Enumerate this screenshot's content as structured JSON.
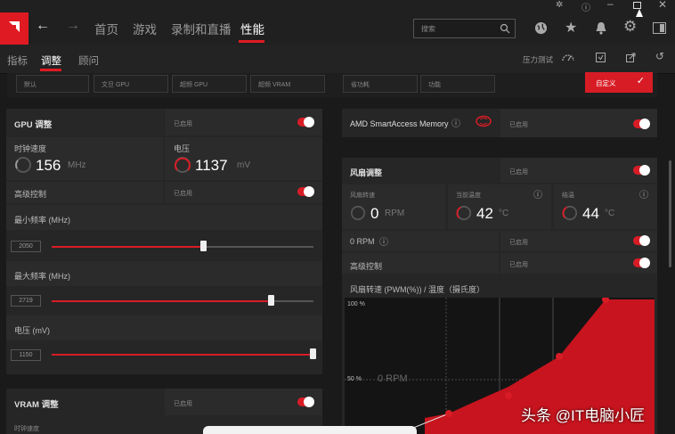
{
  "nav": {
    "items": [
      "首页",
      "游戏",
      "录制和直播",
      "性能"
    ],
    "active_index": 3
  },
  "search": {
    "placeholder": "搜索"
  },
  "subnav": {
    "items": [
      "指标",
      "调整",
      "顾问"
    ],
    "active_index": 1,
    "stress_test": "压力测试"
  },
  "presets": {
    "items": [
      "默认",
      "文旦 GPU",
      "超频 GPU",
      "超频 VRAM",
      "省功耗",
      "功能"
    ],
    "custom_label": "自定义"
  },
  "gpu": {
    "title": "GPU 调整",
    "status": "已启用",
    "clock_label": "时钟速度",
    "clock_value": "156",
    "clock_unit": "MHz",
    "voltage_label": "电压",
    "voltage_value": "1137",
    "voltage_unit": "mV",
    "advanced_label": "高级控制",
    "advanced_status": "已启用",
    "min_freq_label": "最小频率 (MHz)",
    "min_freq_value": "2050",
    "min_freq_fraction": 0.58,
    "max_freq_label": "最大频率 (MHz)",
    "max_freq_value": "2719",
    "max_freq_fraction": 0.84,
    "volt_slider_label": "电压 (mV)",
    "volt_slider_value": "1150",
    "volt_slider_fraction": 1.0
  },
  "vram": {
    "title": "VRAM 调整",
    "status": "已启用",
    "clock_label": "时钟速度"
  },
  "sam": {
    "title": "AMD SmartAccess Memory",
    "status": "已启用"
  },
  "fan": {
    "title": "风扇调整",
    "status": "已启用",
    "speed_label": "风扇转速",
    "speed_value": "0",
    "speed_unit": "RPM",
    "temp_label": "当前温度",
    "temp_value": "42",
    "temp_unit": "°C",
    "hotspot_label": "结温",
    "hotspot_value": "44",
    "hotspot_unit": "°C",
    "zero_rpm_label": "0 RPM",
    "zero_rpm_status": "已启用",
    "advanced_label": "高级控制",
    "advanced_status": "已启用",
    "curve_title": "风扇转速 (PWM(%)) / 温度（摄氏度）",
    "y_top": "100 %",
    "y_mid": "50 %",
    "overlay": "0 RPM"
  },
  "watermark": {
    "text": "头条 @IT电脑小匠"
  },
  "colors": {
    "accent": "#e01a22",
    "bg": "#1a1a1a"
  }
}
